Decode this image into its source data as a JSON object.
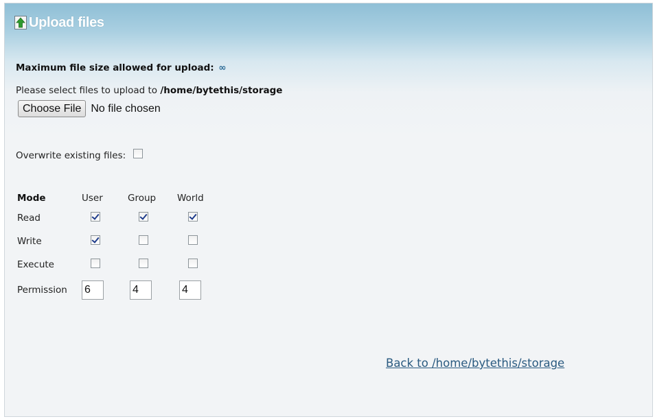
{
  "header": {
    "title": "Upload files",
    "icon": "upload-arrow-icon",
    "icon_color": "#2e9a2e"
  },
  "upload": {
    "max_size_label": "Maximum file size allowed for upload:",
    "max_size_value": "∞",
    "select_prefix": "Please select files to upload to",
    "target_path": "/home/bytethis/storage",
    "choose_button_label": "Choose File",
    "file_status": "No file chosen",
    "overwrite_label": "Overwrite existing files:",
    "overwrite_checked": false
  },
  "permissions": {
    "headers": {
      "mode": "Mode",
      "user": "User",
      "group": "Group",
      "world": "World"
    },
    "rows": [
      {
        "label": "Read",
        "user": true,
        "group": true,
        "world": true
      },
      {
        "label": "Write",
        "user": true,
        "group": false,
        "world": false
      },
      {
        "label": "Execute",
        "user": false,
        "group": false,
        "world": false
      }
    ],
    "permission_label": "Permission",
    "values": {
      "user": "6",
      "group": "4",
      "world": "4"
    }
  },
  "footer": {
    "back_link": "Back to /home/bytethis/storage"
  },
  "colors": {
    "header_gradient_top": "#8fbfd6",
    "background": "#f2f4f6",
    "link": "#2a5a80",
    "checkmark": "#1d3b8a"
  }
}
